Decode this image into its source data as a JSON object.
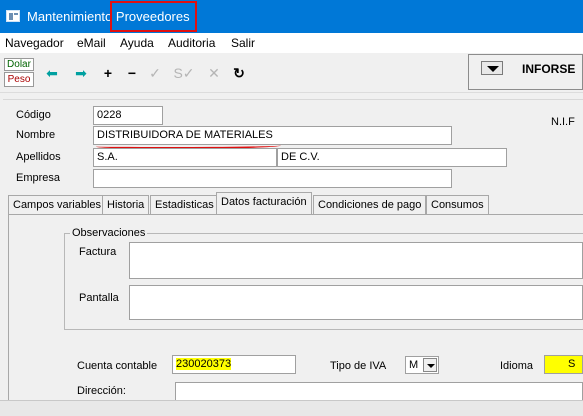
{
  "window": {
    "title_prefix": "Mantenimiento",
    "title_highlight": "Proveedores"
  },
  "menu": [
    "Navegador",
    "eMail",
    "Ayuda",
    "Auditoria",
    "Salir"
  ],
  "currency": {
    "dolar": "Dolar",
    "peso": "Peso"
  },
  "toolbar_icons": [
    "arrow-left-icon",
    "arrow-right-icon",
    "plus-icon",
    "minus-icon",
    "check-icon",
    "check-double-icon",
    "cancel-icon",
    "refresh-icon"
  ],
  "company_box": {
    "label": "INFORSE"
  },
  "form": {
    "codigo_label": "Código",
    "codigo_value": "0228",
    "nombre_label": "Nombre",
    "nombre_value": "DISTRIBUIDORA  DE MATERIALES",
    "apellidos_label": "Apellidos",
    "apellido1_value": "S.A.",
    "apellido2_value": "DE C.V.",
    "empresa_label": "Empresa",
    "empresa_value": "",
    "nif_label": "N.I.F"
  },
  "tabs": [
    "Campos variables",
    "Historia",
    "Estadisticas",
    "Datos facturación",
    "Condiciones de pago",
    "Consumos"
  ],
  "active_tab": "Datos facturación",
  "facturacion": {
    "observaciones_title": "Observaciones",
    "factura_label": "Factura",
    "pantalla_label": "Pantalla",
    "cuenta_label": "Cuenta contable",
    "cuenta_value": "230020373",
    "iva_label": "Tipo de IVA",
    "iva_value": "M",
    "idioma_label": "Idioma",
    "idioma_value": "S",
    "direccion_label": "Dirección:"
  },
  "colors": {
    "titlebar": "#0078d7",
    "highlight_red": "#e01010",
    "highlight_yellow": "#ffff00"
  }
}
